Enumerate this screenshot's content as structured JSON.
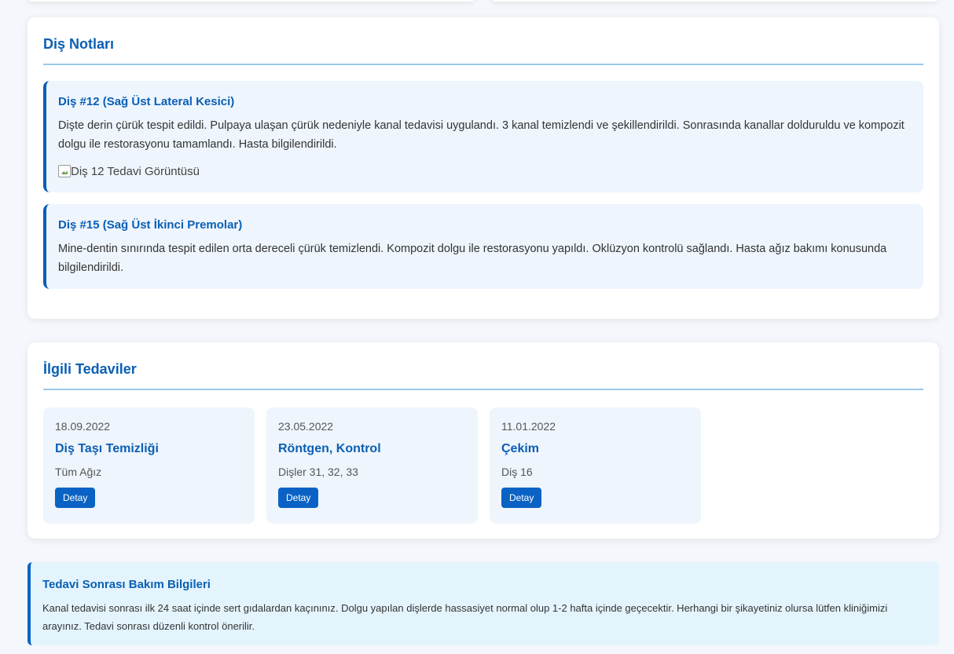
{
  "notes": {
    "title": "Diş Notları",
    "items": [
      {
        "title": "Diş #12 (Sağ Üst Lateral Kesici)",
        "text": "Dişte derin çürük tespit edildi. Pulpaya ulaşan çürük nedeniyle kanal tedavisi uygulandı. 3 kanal temizlendi ve şekillendirildi. Sonrasında kanallar dolduruldu ve kompozit dolgu ile restorasyonu tamamlandı. Hasta bilgilendirildi.",
        "image_alt": "Diş 12 Tedavi Görüntüsü"
      },
      {
        "title": "Diş #15 (Sağ Üst İkinci Premolar)",
        "text": "Mine-dentin sınırında tespit edilen orta dereceli çürük temizlendi. Kompozit dolgu ile restorasyonu yapıldı. Oklüzyon kontrolü sağlandı. Hasta ağız bakımı konusunda bilgilendirildi."
      }
    ]
  },
  "related": {
    "title": "İlgili Tedaviler",
    "items": [
      {
        "date": "18.09.2022",
        "name": "Diş Taşı Temizliği",
        "area": "Tüm Ağız",
        "button": "Detay"
      },
      {
        "date": "23.05.2022",
        "name": "Röntgen, Kontrol",
        "area": "Dişler 31, 32, 33",
        "button": "Detay"
      },
      {
        "date": "11.01.2022",
        "name": "Çekim",
        "area": "Diş 16",
        "button": "Detay"
      }
    ]
  },
  "aftercare": {
    "title": "Tedavi Sonrası Bakım Bilgileri",
    "text": "Kanal tedavisi sonrası ilk 24 saat içinde sert gıdalardan kaçınınız. Dolgu yapılan dişlerde hassasiyet normal olup 1-2 hafta içinde geçecektir. Herhangi bir şikayetiniz olursa lütfen kliniğimizi arayınız. Tedavi sonrası düzenli kontrol önerilir."
  },
  "colors": {
    "accent": "#0a5fb4",
    "button": "#0a63c4",
    "note_bg": "#eef5fd",
    "info_bg": "#e4f4fd"
  }
}
